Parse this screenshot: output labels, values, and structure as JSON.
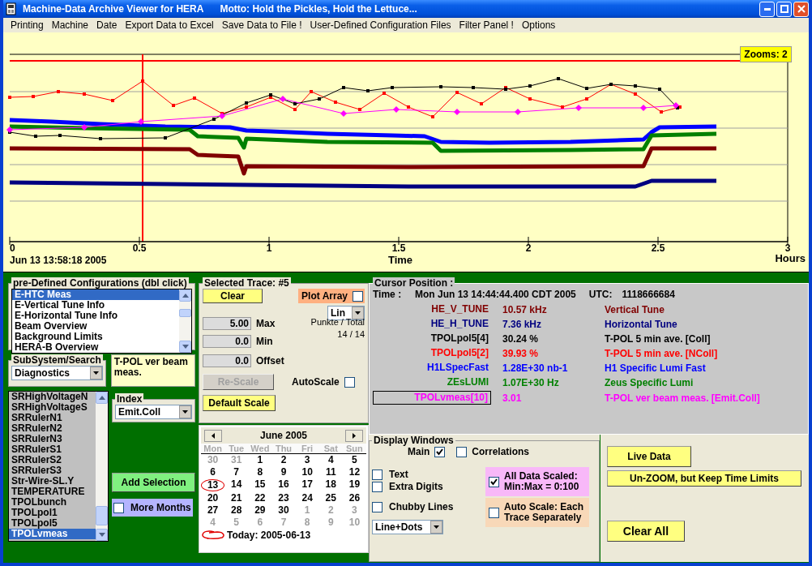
{
  "window": {
    "title": "Machine-Data Archive Viewer for HERA",
    "motto": "Motto: Hold the Pickles, Hold the Lettuce..."
  },
  "menu": [
    "Printing",
    "Machine",
    "Date",
    "Export Data to Excel",
    "Save Data to File !",
    "User-Defined Configuration Files",
    "Filter Panel !",
    "Options"
  ],
  "plot": {
    "zoom_badge": "Zooms: 2",
    "xticks": [
      "0",
      "0.5",
      "1",
      "1.5",
      "2",
      "2.5",
      "3"
    ],
    "start_time": "Jun 13 13:58:18 2005",
    "xlabel": "Time",
    "unit": "Hours"
  },
  "configurations": {
    "title": "pre-Defined Configurations (dbl click)",
    "items": [
      {
        "label": "E-HTC Meas",
        "selected": true
      },
      {
        "label": "E-Vertical Tune Info",
        "selected": false
      },
      {
        "label": "E-Horizontal Tune Info",
        "selected": false
      },
      {
        "label": "Beam Overview",
        "selected": false
      },
      {
        "label": "Background Limits",
        "selected": false
      },
      {
        "label": "HERA-B Overview",
        "selected": false
      }
    ]
  },
  "subsystem": {
    "title": "SubSystem/Search",
    "value": "Diagnostics"
  },
  "description": "T-POL ver beam meas.",
  "channels": [
    {
      "label": "SRHighVoltageN",
      "selected": false
    },
    {
      "label": "SRHighVoltageS",
      "selected": false
    },
    {
      "label": "SRRulerN1",
      "selected": false
    },
    {
      "label": "SRRulerN2",
      "selected": false
    },
    {
      "label": "SRRulerN3",
      "selected": false
    },
    {
      "label": "SRRulerS1",
      "selected": false
    },
    {
      "label": "SRRulerS2",
      "selected": false
    },
    {
      "label": "SRRulerS3",
      "selected": false
    },
    {
      "label": "Str-Wire-SL.Y",
      "selected": false
    },
    {
      "label": "TEMPERATURE",
      "selected": false
    },
    {
      "label": "TPOLbunch",
      "selected": false
    },
    {
      "label": "TPOLpol1",
      "selected": false
    },
    {
      "label": "TPOLpol5",
      "selected": false
    },
    {
      "label": "TPOLvmeas",
      "selected": true
    }
  ],
  "index": {
    "title": "Index",
    "value": "Emit.Coll"
  },
  "add_selection": "Add Selection",
  "more_months": {
    "label": "More Months",
    "checked": false
  },
  "trace": {
    "title": "Selected Trace: #5",
    "clear": "Clear",
    "plot_array": {
      "label": "Plot Array",
      "checked": false
    },
    "scale": "Lin",
    "points_label": "Punkte / Total",
    "points": "14 / 14",
    "fields": [
      {
        "value": "5.00",
        "label": "Max"
      },
      {
        "value": "0.0",
        "label": "Min"
      },
      {
        "value": "0.0",
        "label": "Offset"
      }
    ],
    "rescale": {
      "label": "Re-Scale",
      "disabled": true
    },
    "autoscale": {
      "label": "AutoScale",
      "checked": false
    },
    "default_scale": "Default Scale"
  },
  "calendar": {
    "month": "June 2005",
    "weekdays": [
      "Mon",
      "Tue",
      "Wed",
      "Thu",
      "Fri",
      "Sat",
      "Sun"
    ],
    "days": [
      {
        "label": "30",
        "in_month": false,
        "circled": false
      },
      {
        "label": "31",
        "in_month": false,
        "circled": false
      },
      {
        "label": "1",
        "in_month": true,
        "circled": false
      },
      {
        "label": "2",
        "in_month": true,
        "circled": false
      },
      {
        "label": "3",
        "in_month": true,
        "circled": false
      },
      {
        "label": "4",
        "in_month": true,
        "circled": false
      },
      {
        "label": "5",
        "in_month": true,
        "circled": false
      },
      {
        "label": "6",
        "in_month": true,
        "circled": false
      },
      {
        "label": "7",
        "in_month": true,
        "circled": false
      },
      {
        "label": "8",
        "in_month": true,
        "circled": false
      },
      {
        "label": "9",
        "in_month": true,
        "circled": false
      },
      {
        "label": "10",
        "in_month": true,
        "circled": false
      },
      {
        "label": "11",
        "in_month": true,
        "circled": false
      },
      {
        "label": "12",
        "in_month": true,
        "circled": false
      },
      {
        "label": "13",
        "in_month": true,
        "circled": true
      },
      {
        "label": "14",
        "in_month": true,
        "circled": false
      },
      {
        "label": "15",
        "in_month": true,
        "circled": false
      },
      {
        "label": "16",
        "in_month": true,
        "circled": false
      },
      {
        "label": "17",
        "in_month": true,
        "circled": false
      },
      {
        "label": "18",
        "in_month": true,
        "circled": false
      },
      {
        "label": "19",
        "in_month": true,
        "circled": false
      },
      {
        "label": "20",
        "in_month": true,
        "circled": false
      },
      {
        "label": "21",
        "in_month": true,
        "circled": false
      },
      {
        "label": "22",
        "in_month": true,
        "circled": false
      },
      {
        "label": "23",
        "in_month": true,
        "circled": false
      },
      {
        "label": "24",
        "in_month": true,
        "circled": false
      },
      {
        "label": "25",
        "in_month": true,
        "circled": false
      },
      {
        "label": "26",
        "in_month": true,
        "circled": false
      },
      {
        "label": "27",
        "in_month": true,
        "circled": false
      },
      {
        "label": "28",
        "in_month": true,
        "circled": false
      },
      {
        "label": "29",
        "in_month": true,
        "circled": false
      },
      {
        "label": "30",
        "in_month": true,
        "circled": false
      },
      {
        "label": "1",
        "in_month": false,
        "circled": false
      },
      {
        "label": "2",
        "in_month": false,
        "circled": false
      },
      {
        "label": "3",
        "in_month": false,
        "circled": false
      },
      {
        "label": "4",
        "in_month": false,
        "circled": false
      },
      {
        "label": "5",
        "in_month": false,
        "circled": false
      },
      {
        "label": "6",
        "in_month": false,
        "circled": false
      },
      {
        "label": "7",
        "in_month": false,
        "circled": false
      },
      {
        "label": "8",
        "in_month": false,
        "circled": false
      },
      {
        "label": "9",
        "in_month": false,
        "circled": false
      },
      {
        "label": "10",
        "in_month": false,
        "circled": false
      }
    ],
    "today": "Today: 2005-06-13"
  },
  "cursor": {
    "title": "Cursor Position :",
    "time_label": "Time :",
    "time": "Mon Jun 13 14:44:44.400 CDT 2005",
    "utc_label": "UTC:",
    "utc": "1118666684",
    "rows": [
      {
        "name": "HE_V_TUNE",
        "value": "10.57 kHz",
        "description": "Vertical Tune",
        "color": "#800000",
        "selected": false
      },
      {
        "name": "HE_H_TUNE",
        "value": "7.36 kHz",
        "description": "Horizontal Tune",
        "color": "#000080",
        "selected": false
      },
      {
        "name": "TPOLpol5[4]",
        "value": "30.24 %",
        "description": "T-POL 5 min ave. [Coll]",
        "color": "#000000",
        "selected": false
      },
      {
        "name": "TPOLpol5[2]",
        "value": "39.93 %",
        "description": "T-POL 5 min ave. [NColl]",
        "color": "#ff0000",
        "selected": false
      },
      {
        "name": "H1LSpecFast",
        "value": "1.28E+30 nb-1",
        "description": "H1 Specific Lumi Fast",
        "color": "#0000ff",
        "selected": false
      },
      {
        "name": "ZEsLUMI",
        "value": "1.07E+30 Hz",
        "description": "Zeus Specific Lumi",
        "color": "#008000",
        "selected": false
      },
      {
        "name": "TPOLvmeas[10]",
        "value": "3.01",
        "description": "T-POL ver beam meas. [Emit.Coll]",
        "color": "#ff00ff",
        "selected": true
      }
    ]
  },
  "display": {
    "title": "Display Windows",
    "main": {
      "label": "Main",
      "checked": true
    },
    "correlations": {
      "label": "Correlations",
      "checked": false
    },
    "options": [
      {
        "label": "Text",
        "checked": false
      },
      {
        "label": "Extra Digits",
        "checked": false
      },
      {
        "label": "Chubby Lines",
        "checked": false
      }
    ],
    "all_scaled": {
      "label": "All Data Scaled: Min:Max = 0:100",
      "checked": true
    },
    "auto_each": {
      "label": "Auto Scale: Each Trace Separately",
      "checked": false
    },
    "line_style": "Line+Dots"
  },
  "actions": [
    "Live Data",
    "Un-ZOOM, but Keep Time Limits",
    "Clear All"
  ]
}
